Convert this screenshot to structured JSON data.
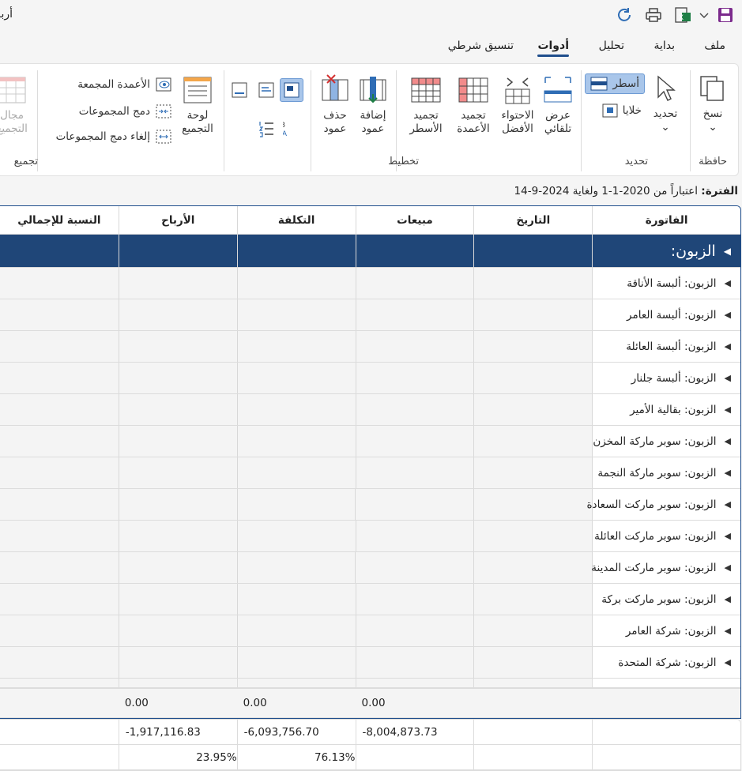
{
  "window": {
    "title": "أرباح"
  },
  "menu": {
    "tabs": [
      {
        "label": "ملف"
      },
      {
        "label": "بداية"
      },
      {
        "label": "تحليل"
      },
      {
        "label": "أدوات"
      },
      {
        "label": "تنسيق شرطي"
      }
    ]
  },
  "ribbon": {
    "clipboard": {
      "group": "حافظة",
      "copy": "نسخ"
    },
    "select": {
      "group": "تحديد",
      "select": "تحديد",
      "rows": "أسطر",
      "cells": "خلايا"
    },
    "layout": {
      "group": "تخطيط",
      "autofit": [
        "عرض",
        "تلقائي"
      ],
      "bestfit": [
        "الاحتواء",
        "الأفضل"
      ],
      "freeze_cols": [
        "تجميد",
        "الأعمدة"
      ],
      "freeze_rows": [
        "تجميد",
        "الأسطر"
      ],
      "add_col": [
        "إضافة",
        "عمود"
      ],
      "del_col": [
        "حذف",
        "عمود"
      ]
    },
    "grouping": {
      "group": "تجميع",
      "panel": [
        "لوحة",
        "التجميع"
      ],
      "grouped_cols": "الأعمدة المجمعة",
      "merge": "دمج المجموعات",
      "unmerge": "إلغاء دمج المجموعات",
      "range": [
        "مجال",
        "التجميع"
      ]
    }
  },
  "period": {
    "label": "الفترة:",
    "text": "اعتباراً من 2020-1-1 ولغاية 2024-9-14"
  },
  "grid": {
    "columns": [
      "الفاتورة",
      "التاريخ",
      "مبيعات",
      "التكلفة",
      "الأرباح",
      "النسبة للإجمالي"
    ],
    "group_title": "الزبون:",
    "rows": [
      "الزبون: ألبسة الأناقة",
      "الزبون: ألبسة العامر",
      "الزبون: ألبسة العائلة",
      "الزبون: ألبسة جلنار",
      "الزبون: بقالية الأمير",
      "الزبون: سوبر ماركة المخزن",
      "الزبون: سوبر ماركة النجمة",
      "الزبون: سوبر ماركت السعادة",
      "الزبون: سوبر ماركت العائلة",
      "الزبون: سوبر ماركت المدينة",
      "الزبون: سوبر ماركت بركة",
      "الزبون: شركة العامر",
      "الزبون: شركة المتحدة"
    ],
    "totals": {
      "sales": "0.00",
      "cost": "0.00",
      "profit": "0.00"
    },
    "footer": {
      "sales": "-8,004,873.73",
      "cost": "-6,093,756.70",
      "profit": "-1,917,116.83",
      "cost_pct": "76.13%",
      "profit_pct": "23.95%"
    }
  },
  "colors": {
    "accent": "#1f4678",
    "excel_green": "#1e7e45",
    "purple": "#7b2a8c"
  }
}
